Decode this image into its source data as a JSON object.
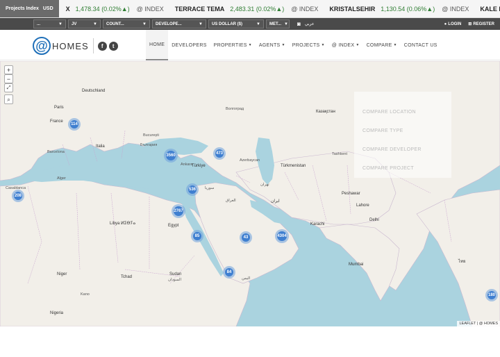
{
  "ticker": {
    "label": "Projects Index",
    "currency": "USD",
    "items": [
      {
        "name": "X",
        "value": "1,478.34 (0.02%▲)",
        "index": "@ INDEX"
      },
      {
        "name": "TERRACE TEMA",
        "value": "2,483.31 (0.02%▲)",
        "index": "@ INDEX"
      },
      {
        "name": "KRISTALSEHIR",
        "value": "1,130.54 (0.06%▲)",
        "index": "@ INDEX"
      },
      {
        "name": "KALE KENT",
        "value": "",
        "index": ""
      }
    ]
  },
  "filters": {
    "items": [
      "...",
      "JV",
      "COUNT...",
      "DEVELOPE...",
      "US DOLLAR ($)",
      "MET..."
    ],
    "lang": "عربي",
    "login": "LOGIN",
    "register": "REGISTER"
  },
  "nav": {
    "logo_text": "HOMES",
    "items": [
      "HOME",
      "DEVELOPERS",
      "PROPERTIES",
      "AGENTS",
      "PROJECTS",
      "@ INDEX",
      "COMPARE",
      "CONTACT US"
    ],
    "has_caret": [
      false,
      false,
      true,
      true,
      true,
      true,
      true,
      false
    ]
  },
  "map": {
    "zoom_in": "+",
    "zoom_out": "−",
    "attribution": "LEAFLET | @ HOMES",
    "clusters": [
      {
        "count": "114",
        "size": 18
      },
      {
        "count": "3560",
        "size": 20
      },
      {
        "count": "473",
        "size": 18
      },
      {
        "count": "536",
        "size": 18
      },
      {
        "count": "208",
        "size": 18
      },
      {
        "count": "2767",
        "size": 20
      },
      {
        "count": "85",
        "size": 18
      },
      {
        "count": "43",
        "size": 18
      },
      {
        "count": "4304",
        "size": 20
      },
      {
        "count": "84",
        "size": 18
      },
      {
        "count": "180",
        "size": 18
      }
    ],
    "compare_menu": [
      "COMPARE LOCATION",
      "COMPARE TYPE",
      "COMPARE DEVELOPER",
      "COMPARE PROJECT"
    ],
    "labels": [
      "Deutschland",
      "Paris",
      "France",
      "Barcelona",
      "Italia",
      "București",
      "България",
      "Ankara",
      "Türkiye",
      "Волгоград",
      "Казақстан",
      "Tashkent",
      "Azerbaycan",
      "Türkmenistan",
      "تهران",
      "ایران",
      "سوريا",
      "العراق",
      "Egypt",
      "Libya ⵍⵉⴱⵢⴰ",
      "Alger",
      "Casablanca",
      "Sudan",
      "السودان",
      "Tchad",
      "Niger",
      "Nigeria",
      "Kano",
      "اليمن",
      "Mumbai",
      "Delhi",
      "Lahore",
      "Peshawar",
      "Karachi",
      "ไทย"
    ]
  }
}
